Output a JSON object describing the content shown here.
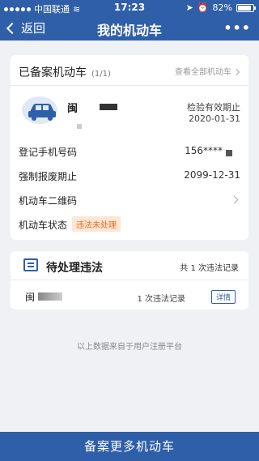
{
  "status": {
    "carrier": "中国联通",
    "time": "17:23",
    "battery": "82%"
  },
  "nav": {
    "back_label": "返回",
    "title": "我的机动车",
    "more": "•••"
  },
  "registered": {
    "title": "已备案机动车",
    "count": "(1/1)",
    "view_all": "查看全部机动车",
    "plate_prefix": "闽",
    "inspection_label": "检验有效期止",
    "inspection_date": "2020-01-31",
    "rows": [
      {
        "label": "登记手机号码",
        "value": "156****"
      },
      {
        "label": "强制报废期止",
        "value": "2099-12-31"
      },
      {
        "label": "机动车二维码",
        "value": ""
      },
      {
        "label": "机动车状态",
        "value": "违法未处理"
      }
    ]
  },
  "violations": {
    "title": "待处理违法",
    "total": "共 1 次违法记录",
    "plate_prefix": "闽",
    "record": "1 次违法记录",
    "detail_button": "详情"
  },
  "footnote": "以上数据来自于用户注册平台",
  "bottom_button": "备案更多机动车"
}
